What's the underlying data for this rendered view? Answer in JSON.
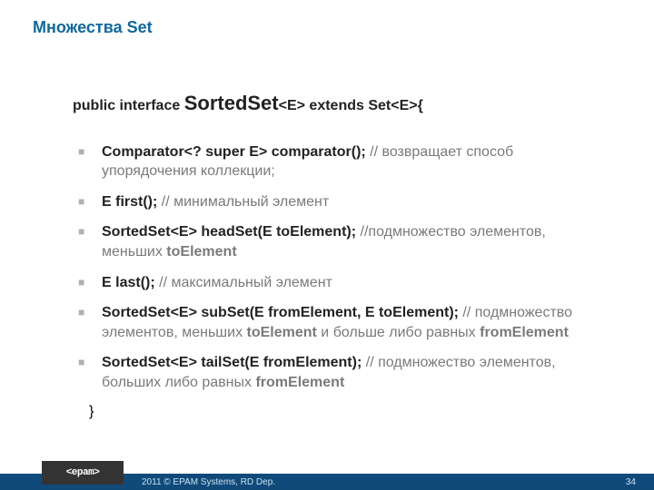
{
  "title": "Множества Set",
  "decl": {
    "prefix": "public interface ",
    "name": "SortedSet",
    "generic": "<E>",
    "extends": " extends Set<E>",
    "open": "{"
  },
  "items": [
    {
      "sig": "Comparator<? super E> comparator();",
      "comment_prefix": " // ",
      "comment": "возвращает способ упорядочения коллекции;"
    },
    {
      "sig": "E first();",
      "comment_prefix": " // ",
      "comment": "минимальный элемент"
    },
    {
      "sig": "SortedSet<E> headSet(E toElement);",
      "comment_prefix": " //",
      "comment": "подмножество элементов, меньших ",
      "kw": "toElement"
    },
    {
      "sig": "E last();",
      "comment_prefix": " // ",
      "comment": "максимальный элемент"
    },
    {
      "sig": "SortedSet<E> subSet(E fromElement, E toElement);",
      "comment_prefix": " // ",
      "comment_a": "подмножество элементов, меньших ",
      "kw_a": "toElement",
      "comment_b": " и больше либо равных ",
      "kw_b": "fromElement"
    },
    {
      "sig": "SortedSet<E> tailSet(E fromElement);",
      "comment_prefix": " // ",
      "comment": "подмножество элементов, больших либо равных ",
      "kw": "fromElement"
    }
  ],
  "close_brace": "}",
  "footer": {
    "logo": "<epam>",
    "copyright": "2011 © EPAM Systems, RD Dep.",
    "page": "34"
  }
}
